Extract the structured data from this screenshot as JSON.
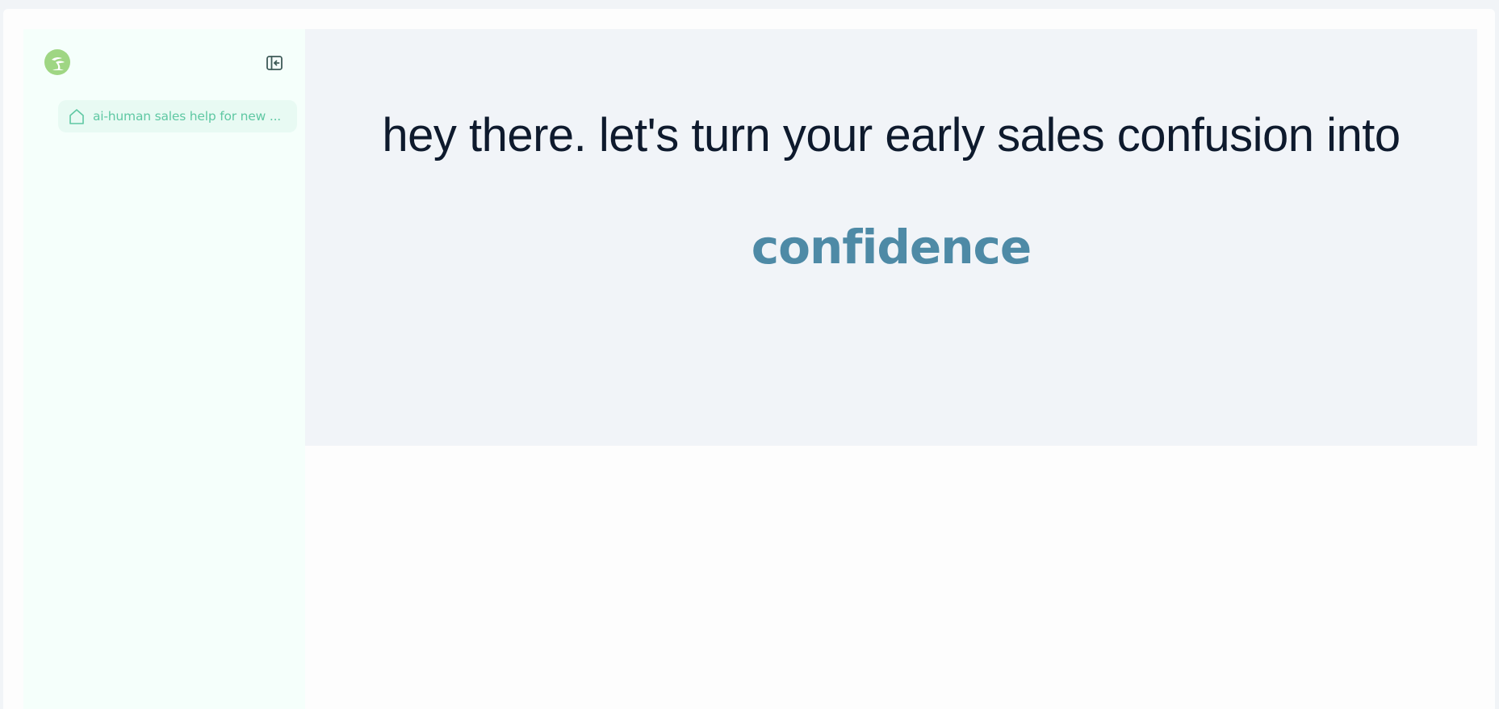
{
  "sidebar": {
    "logo_icon": "bonsai-tree-logo-icon",
    "collapse_icon": "collapse-sidebar-icon",
    "items": [
      {
        "icon": "home-icon",
        "label": "ai-human sales help for new ..."
      }
    ]
  },
  "hero": {
    "headline": "hey there. let's turn your early sales confusion into",
    "accent": "confidence"
  },
  "colors": {
    "page_bg": "#f1f4f7",
    "sidebar_bg": "#f5fffb",
    "nav_item_bg": "#e8faf3",
    "nav_item_text": "#5fc8a3",
    "hero_bg": "#f1f4f8",
    "headline_text": "#0e1a2d",
    "accent_text": "#4e8aa6",
    "logo_green": "#9fd683"
  }
}
